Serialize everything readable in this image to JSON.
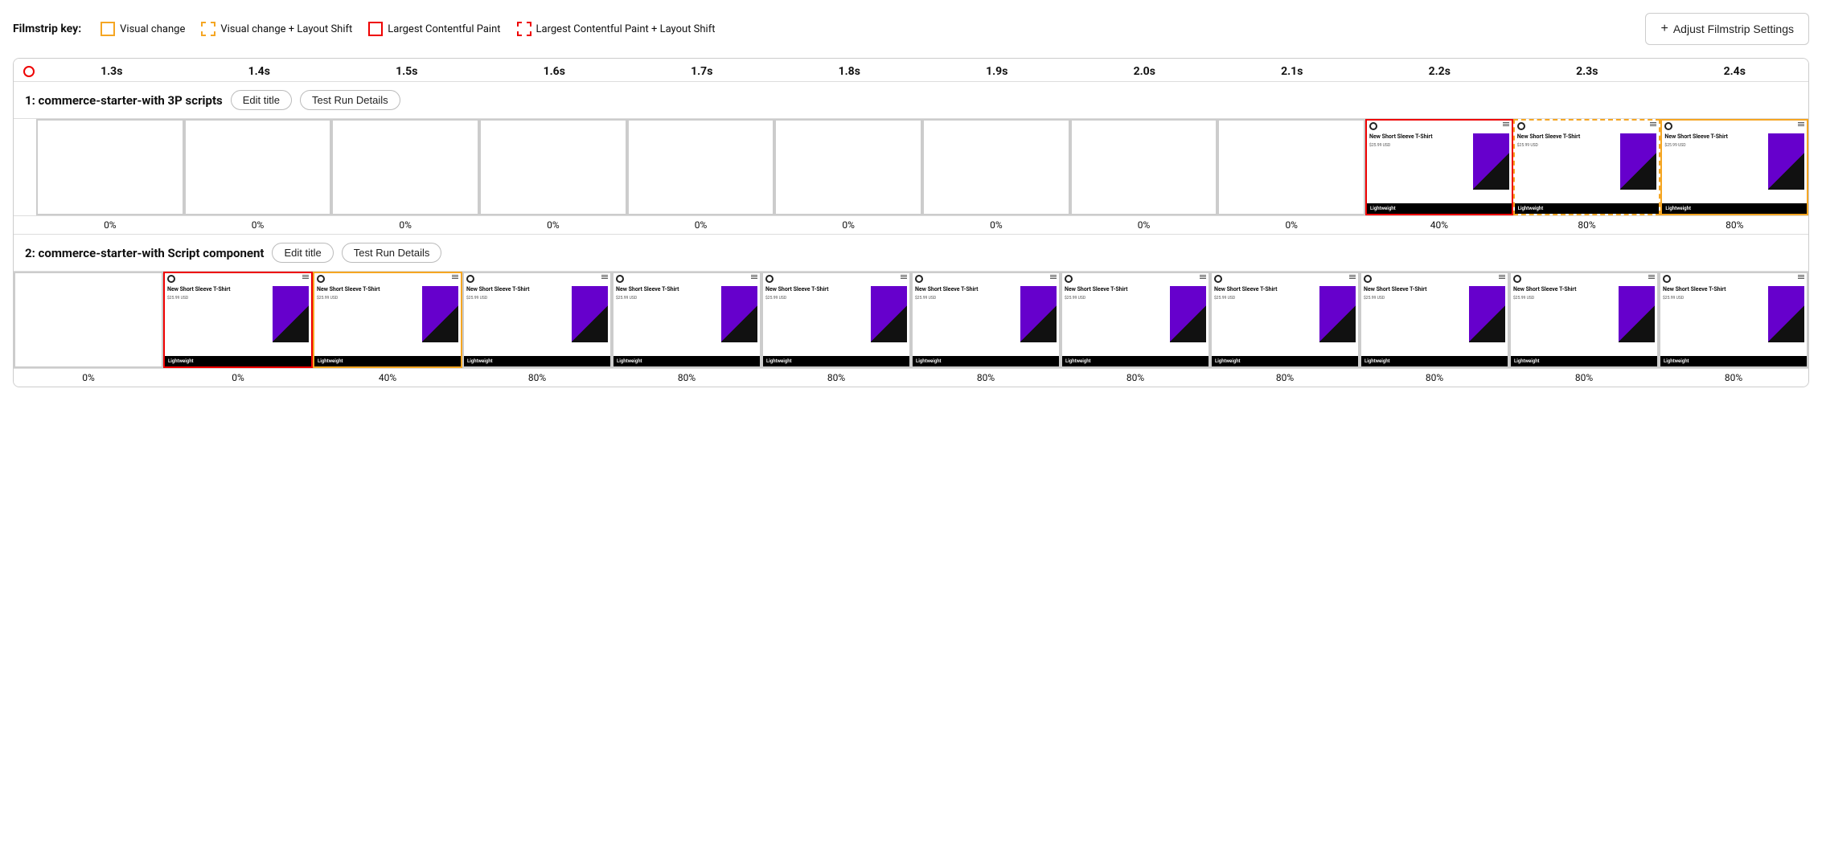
{
  "legend": {
    "label": "Filmstrip key:",
    "items": [
      {
        "id": "visual-change",
        "label": "Visual change",
        "boxType": "solid-yellow"
      },
      {
        "id": "visual-change-layout",
        "label": "Visual change + Layout Shift",
        "boxType": "dashed-yellow"
      },
      {
        "id": "lcp",
        "label": "Largest Contentful Paint",
        "boxType": "solid-red"
      },
      {
        "id": "lcp-layout",
        "label": "Largest Contentful Paint + Layout Shift",
        "boxType": "dashed-red"
      }
    ]
  },
  "adjust_btn": "Adjust Filmstrip Settings",
  "timeline": {
    "ticks": [
      "1.3s",
      "1.4s",
      "1.5s",
      "1.6s",
      "1.7s",
      "1.8s",
      "1.9s",
      "2.0s",
      "2.1s",
      "2.2s",
      "2.3s",
      "2.4s"
    ]
  },
  "rows": [
    {
      "id": "row1",
      "title": "1: commerce-starter-with 3P scripts",
      "edit_label": "Edit title",
      "details_label": "Test Run Details",
      "frames": [
        {
          "border": "none",
          "empty": true,
          "percent": "0%"
        },
        {
          "border": "none",
          "empty": true,
          "percent": "0%"
        },
        {
          "border": "none",
          "empty": true,
          "percent": "0%"
        },
        {
          "border": "none",
          "empty": true,
          "percent": "0%"
        },
        {
          "border": "none",
          "empty": true,
          "percent": "0%"
        },
        {
          "border": "none",
          "empty": true,
          "percent": "0%"
        },
        {
          "border": "none",
          "empty": true,
          "percent": "0%"
        },
        {
          "border": "none",
          "empty": true,
          "percent": "0%"
        },
        {
          "border": "none",
          "empty": true,
          "percent": "0%"
        },
        {
          "border": "solid-red",
          "empty": false,
          "percent": "40%"
        },
        {
          "border": "dashed-yellow",
          "empty": false,
          "percent": "80%"
        },
        {
          "border": "solid-yellow",
          "empty": false,
          "percent": "80%"
        }
      ],
      "first_frame_border": "solid-red"
    },
    {
      "id": "row2",
      "title": "2: commerce-starter-with Script component",
      "edit_label": "Edit title",
      "details_label": "Test Run Details",
      "frames": [
        {
          "border": "solid-red",
          "empty": false,
          "percent": "0%"
        },
        {
          "border": "solid-yellow",
          "empty": false,
          "percent": "40%"
        },
        {
          "border": "none",
          "empty": false,
          "percent": "80%"
        },
        {
          "border": "none",
          "empty": false,
          "percent": "80%"
        },
        {
          "border": "none",
          "empty": false,
          "percent": "80%"
        },
        {
          "border": "none",
          "empty": false,
          "percent": "80%"
        },
        {
          "border": "none",
          "empty": false,
          "percent": "80%"
        },
        {
          "border": "none",
          "empty": false,
          "percent": "80%"
        },
        {
          "border": "none",
          "empty": false,
          "percent": "80%"
        },
        {
          "border": "none",
          "empty": false,
          "percent": "80%"
        },
        {
          "border": "none",
          "empty": false,
          "percent": "80%"
        }
      ],
      "first_frame_border": "none"
    }
  ],
  "product": {
    "title": "New Short Sleeve T-Shirt",
    "price": "$25.99 USD",
    "footer": "Lightweight"
  }
}
